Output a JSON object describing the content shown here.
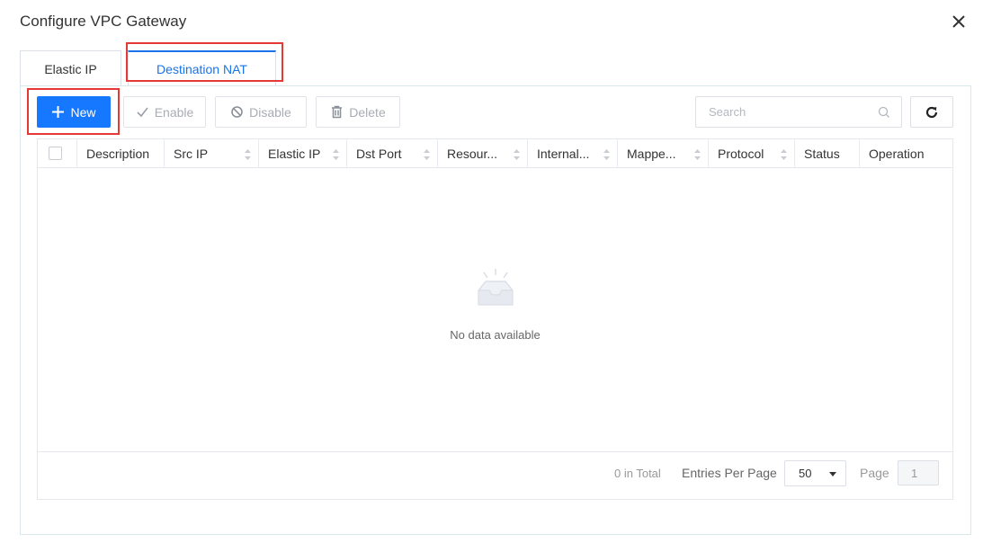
{
  "dialog": {
    "title": "Configure VPC Gateway"
  },
  "tabs": [
    {
      "label": "Elastic IP",
      "active": false
    },
    {
      "label": "Destination NAT",
      "active": true
    }
  ],
  "toolbar": {
    "new_label": "New",
    "enable_label": "Enable",
    "disable_label": "Disable",
    "delete_label": "Delete",
    "search_placeholder": "Search"
  },
  "table": {
    "columns": [
      "Description",
      "Src IP",
      "Elastic IP",
      "Dst Port",
      "Resour...",
      "Internal...",
      "Mappe...",
      "Protocol",
      "Status",
      "Operation"
    ],
    "rows": [],
    "empty_text": "No data available"
  },
  "pagination": {
    "total": "0 in Total",
    "entries_label": "Entries Per Page",
    "entries_value": "50",
    "page_label": "Page",
    "page_value": "1"
  },
  "colors": {
    "accent": "#1677ff",
    "tab_active": "#1a73e8",
    "annotation": "#e53935"
  }
}
